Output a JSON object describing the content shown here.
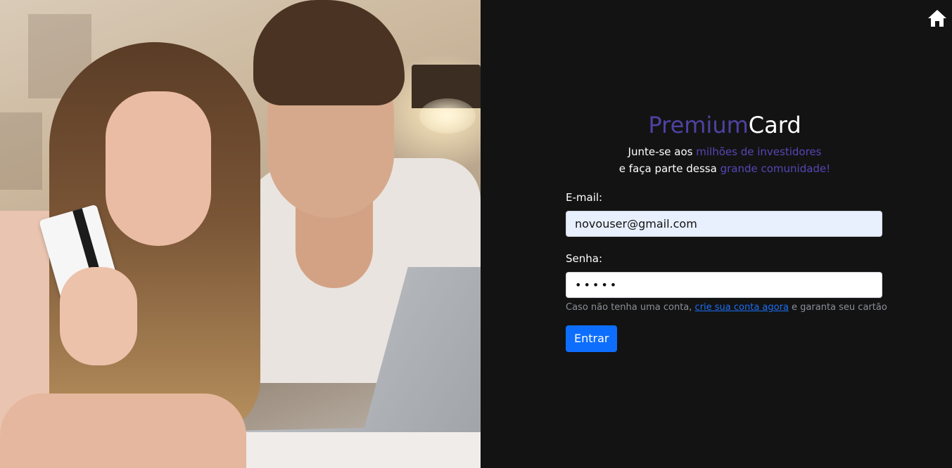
{
  "brand": {
    "part1": "Premium",
    "part2": "Card"
  },
  "tagline": {
    "line1_prefix": "Junte-se aos ",
    "line1_accent": "milhões de investidores",
    "line2_prefix": "e faça parte dessa ",
    "line2_accent": "grande comunidade!"
  },
  "form": {
    "email_label": "E-mail:",
    "email_value": "novouser@gmail.com",
    "password_label": "Senha:",
    "password_value": "•••••",
    "hint_prefix": "Caso não tenha uma conta, ",
    "hint_link": "crie sua conta agora",
    "hint_suffix": " e garanta seu cartão",
    "submit_label": "Entrar"
  },
  "icons": {
    "home": "home-icon"
  },
  "colors": {
    "accent": "#4e42a3",
    "button": "#0d6efd",
    "link": "#1b6ff5",
    "background": "#131313"
  }
}
